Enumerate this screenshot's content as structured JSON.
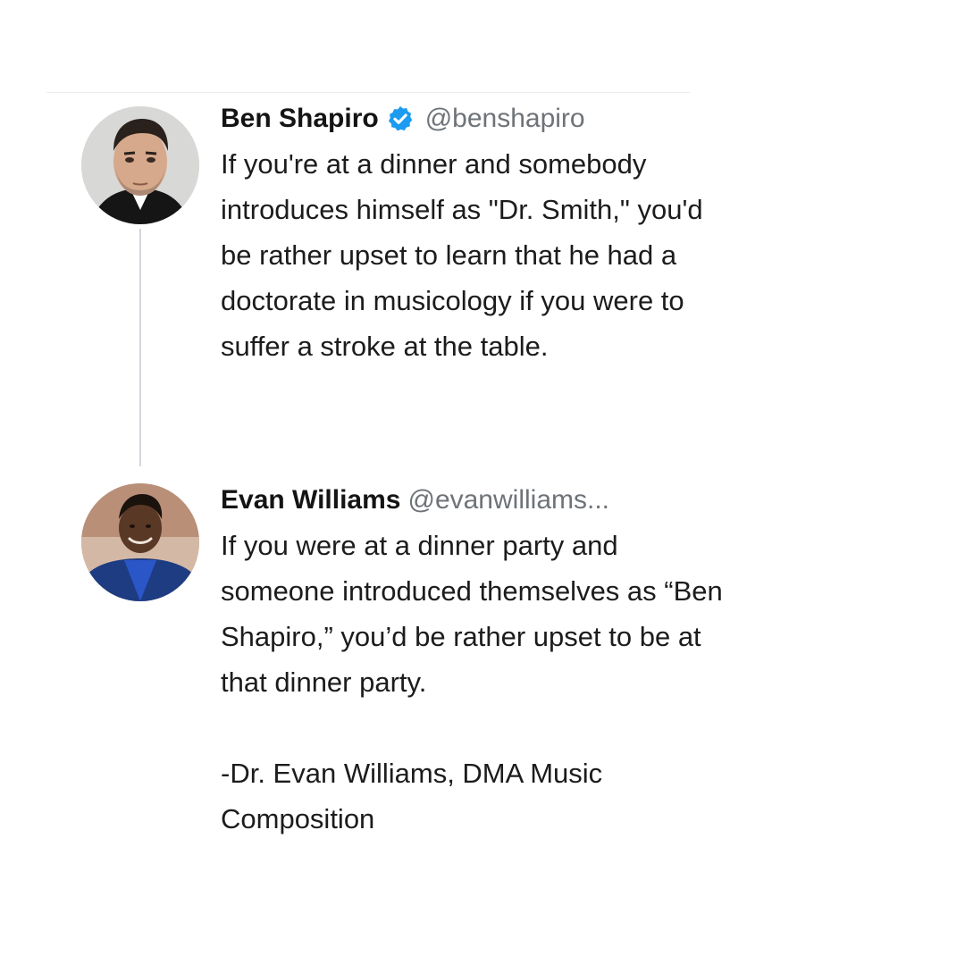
{
  "tweets": [
    {
      "name": "Ben Shapiro",
      "verified": true,
      "handle": "@benshapiro",
      "lines": [
        "If you're at a dinner and somebody",
        "introduces himself as \"Dr. Smith,\" you'd",
        "be rather upset to learn that he had a",
        "doctorate in musicology if you were to",
        "suffer a stroke at the table."
      ]
    },
    {
      "name": "Evan Williams",
      "verified": false,
      "handle": "@evanwilliams...",
      "lines": [
        "If you were at a dinner party and",
        "someone introduced themselves as “Ben",
        "Shapiro,” you’d be rather upset to be at",
        "that dinner party."
      ],
      "signature_lines": [
        "-Dr. Evan Williams, DMA Music",
        "Composition"
      ]
    }
  ],
  "colors": {
    "verified_badge": "#1d9bf0",
    "handle": "#6e7378",
    "thread_line": "#d3d6da"
  },
  "icons": {
    "verified": "verified-badge-icon"
  }
}
